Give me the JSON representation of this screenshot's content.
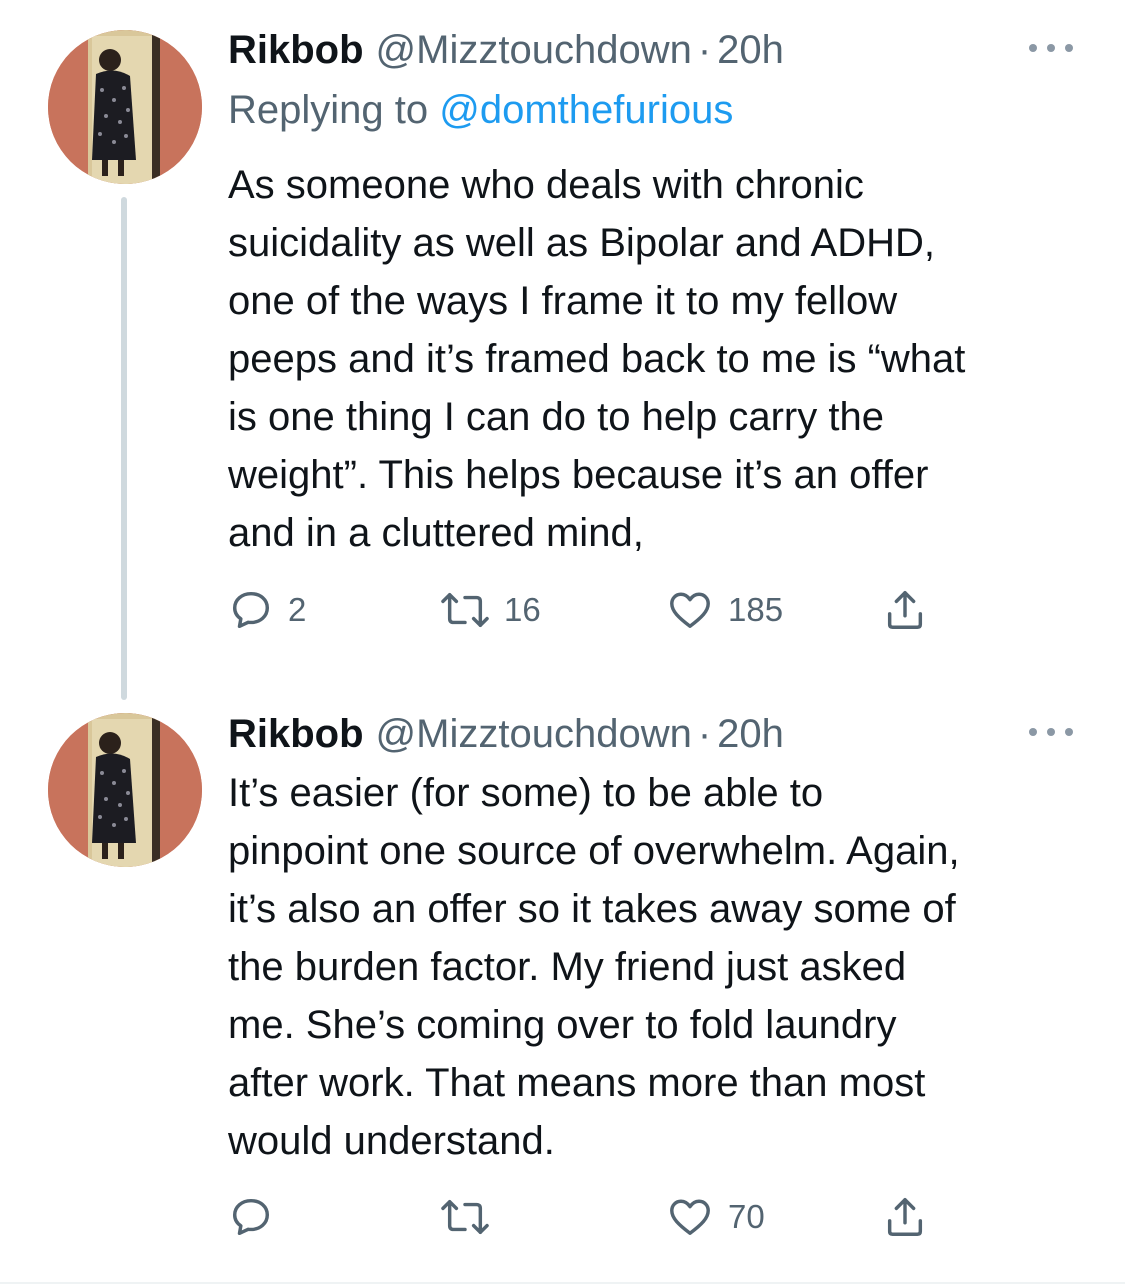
{
  "tweets": [
    {
      "author": {
        "name": "Rikbob",
        "handle": "@Mizztouchdown",
        "separator": "·",
        "time": "20h"
      },
      "replying_to": {
        "prefix": "Replying to",
        "mention": "@domthefurious"
      },
      "text": "As someone who deals with chronic\nsuicidality as well as Bipolar and ADHD,\none of the ways I frame it to my fellow\npeeps and it’s framed back to me is “what\nis one thing I can do to help carry the\nweight”. This helps because it’s an offer\nand in a cluttered mind,",
      "actions": {
        "reply_count": "2",
        "retweet_count": "16",
        "like_count": "185",
        "share_count": ""
      }
    },
    {
      "author": {
        "name": "Rikbob",
        "handle": "@Mizztouchdown",
        "separator": "·",
        "time": "20h"
      },
      "text": "It’s easier (for some) to be able to\npinpoint one source of overwhelm. Again,\nit’s also an offer so it takes away some of\nthe burden factor. My friend just asked\nme. She’s coming over to fold laundry\nafter work. That means more than most\nwould understand.",
      "actions": {
        "reply_count": "",
        "retweet_count": "",
        "like_count": "70",
        "share_count": ""
      }
    }
  ],
  "icons": {
    "more": "more-horizontal-icon",
    "reply": "speech-bubble-icon",
    "retweet": "retweet-arrows-icon",
    "like": "heart-outline-icon",
    "share": "share-upload-icon"
  },
  "colors": {
    "text_primary": "#0f1419",
    "text_secondary": "#536471",
    "link": "#1d9bf0",
    "thread_line": "#cfd9de"
  }
}
